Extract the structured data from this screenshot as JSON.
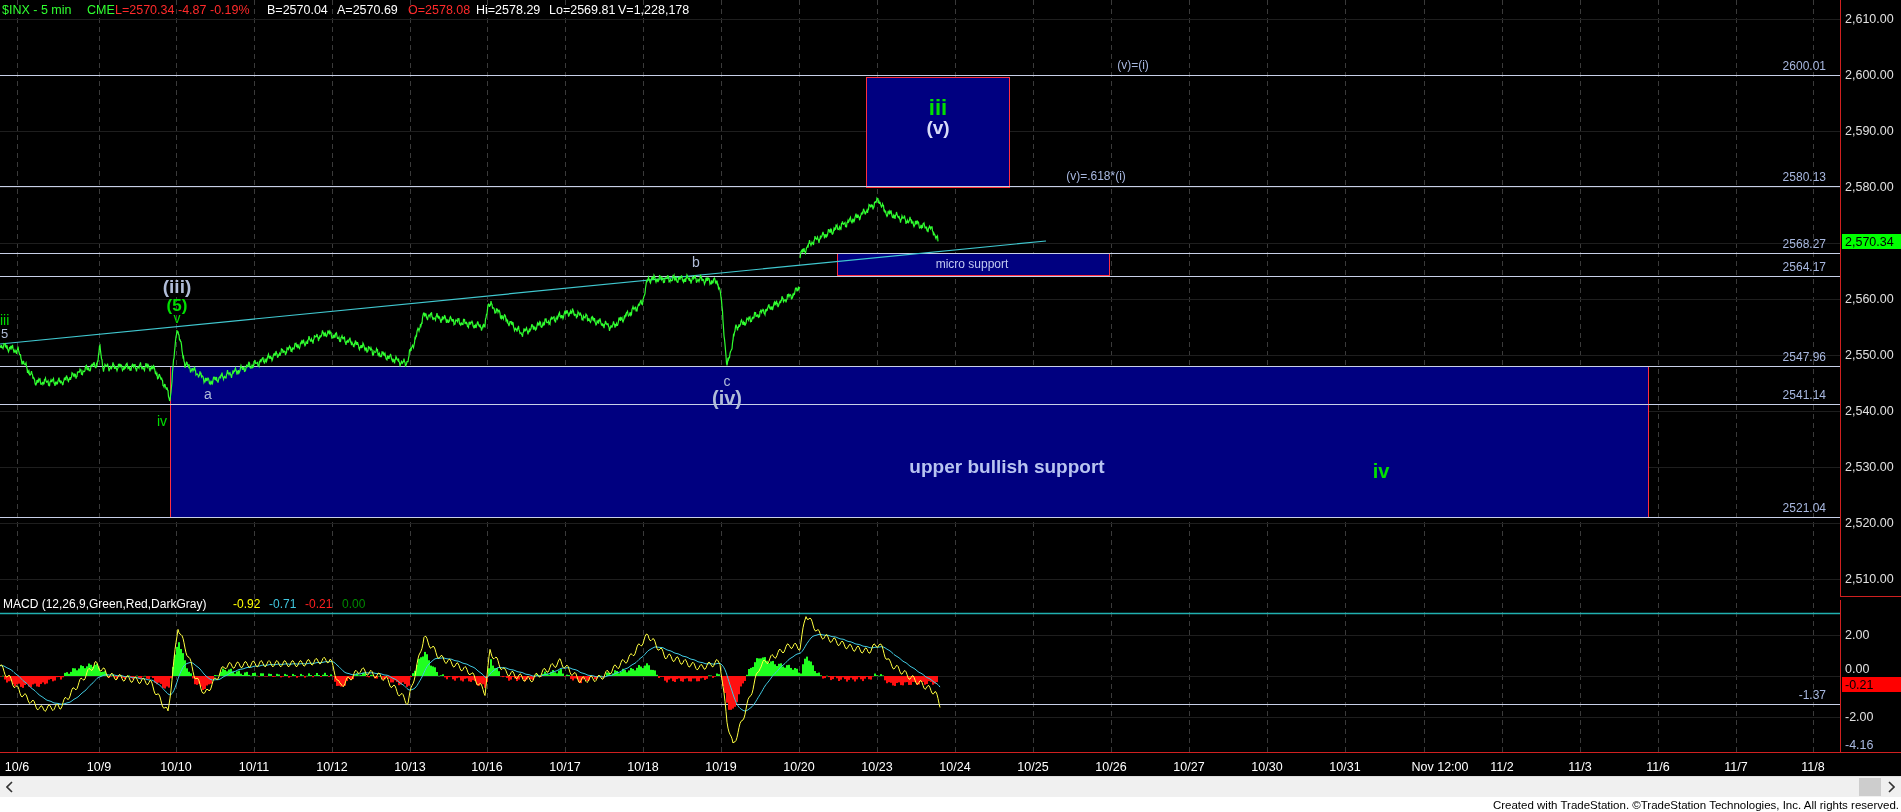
{
  "header": {
    "symbol": "$INX - 5 min",
    "exchange": "CME",
    "quotes": [
      {
        "text": "L=2570.34",
        "color": "#ff2a2a"
      },
      {
        "text": "-4.87",
        "color": "#ff2a2a"
      },
      {
        "text": "-0.19%",
        "color": "#ff2a2a"
      },
      {
        "text": "B=2570.04",
        "color": "#ffffff"
      },
      {
        "text": "A=2570.69",
        "color": "#ffffff"
      },
      {
        "text": "O=2578.08",
        "color": "#ff2a2a"
      },
      {
        "text": "Hi=2578.29",
        "color": "#ffffff"
      },
      {
        "text": "Lo=2569.81",
        "color": "#ffffff"
      },
      {
        "text": "V=1,228,178",
        "color": "#ffffff"
      }
    ]
  },
  "price_axis": {
    "ticks": [
      "2,610.00",
      "2,600.00",
      "2,590.00",
      "2,580.00",
      "2,560.00",
      "2,550.00",
      "2,540.00",
      "2,530.00",
      "2,520.00",
      "2,510.00"
    ],
    "last_price": "2,570.34"
  },
  "levels": [
    {
      "label": "2600.01",
      "note": "(v)=(i)"
    },
    {
      "label": "2580.13",
      "note": "(v)=.618*(i)"
    },
    {
      "label": "2568.27"
    },
    {
      "label": "2564.17"
    },
    {
      "label": "2547.96"
    },
    {
      "label": "2541.14"
    },
    {
      "label": "2521.04"
    }
  ],
  "zones": [
    {
      "kind": "target",
      "labels": [
        {
          "text": "iii",
          "color": "#00e000"
        },
        {
          "text": "(v)",
          "color": "#d8dcf8"
        }
      ]
    },
    {
      "kind": "micro",
      "labels": [
        {
          "text": "micro support",
          "color": "#c0c8f0"
        }
      ]
    },
    {
      "kind": "support",
      "labels": [
        {
          "text": "upper bullish support",
          "color": "#b8c4f0"
        },
        {
          "text": "iv",
          "color": "#00e000"
        }
      ]
    }
  ],
  "wave_labels": [
    {
      "text": "iii",
      "color": "#00e000"
    },
    {
      "text": "5",
      "color": "#b0bcd8"
    },
    {
      "text": "(iii)",
      "color": "#b0bcd8"
    },
    {
      "text": "(5)",
      "color": "#00e000"
    },
    {
      "text": "v",
      "color": "#00e000"
    },
    {
      "text": "iv",
      "color": "#00e000"
    },
    {
      "text": "a",
      "color": "#b0bcd8"
    },
    {
      "text": "b",
      "color": "#b0bcd8"
    },
    {
      "text": "c",
      "color": "#b0bcd8"
    },
    {
      "text": "(iv)",
      "color": "#b0bcd8"
    }
  ],
  "macd": {
    "title": "MACD (12,26,9,Green,Red,DarkGray)",
    "values": [
      {
        "text": "-0.92",
        "color": "#ffff00"
      },
      {
        "text": "-0.71",
        "color": "#40c8e0"
      },
      {
        "text": "-0.21",
        "color": "#ff2020"
      },
      {
        "text": "0.00",
        "color": "#008a00"
      }
    ],
    "ticks": [
      "2.00",
      "0.00",
      "-2.00",
      "-4.16"
    ],
    "level_label": "-1.37",
    "last_value": "-0.21"
  },
  "date_axis": [
    "10/6",
    "10/9",
    "10/10",
    "10/11",
    "10/12",
    "10/13",
    "10/16",
    "10/17",
    "10/18",
    "10/19",
    "10/20",
    "10/23",
    "10/24",
    "10/25",
    "10/26",
    "10/27",
    "10/30",
    "10/31",
    "Nov 12:00",
    "11/2",
    "11/3",
    "11/6",
    "11/7",
    "11/8"
  ],
  "footer": "Created with TradeStation. ©TradeStation Technologies, Inc. All rights reserved."
}
